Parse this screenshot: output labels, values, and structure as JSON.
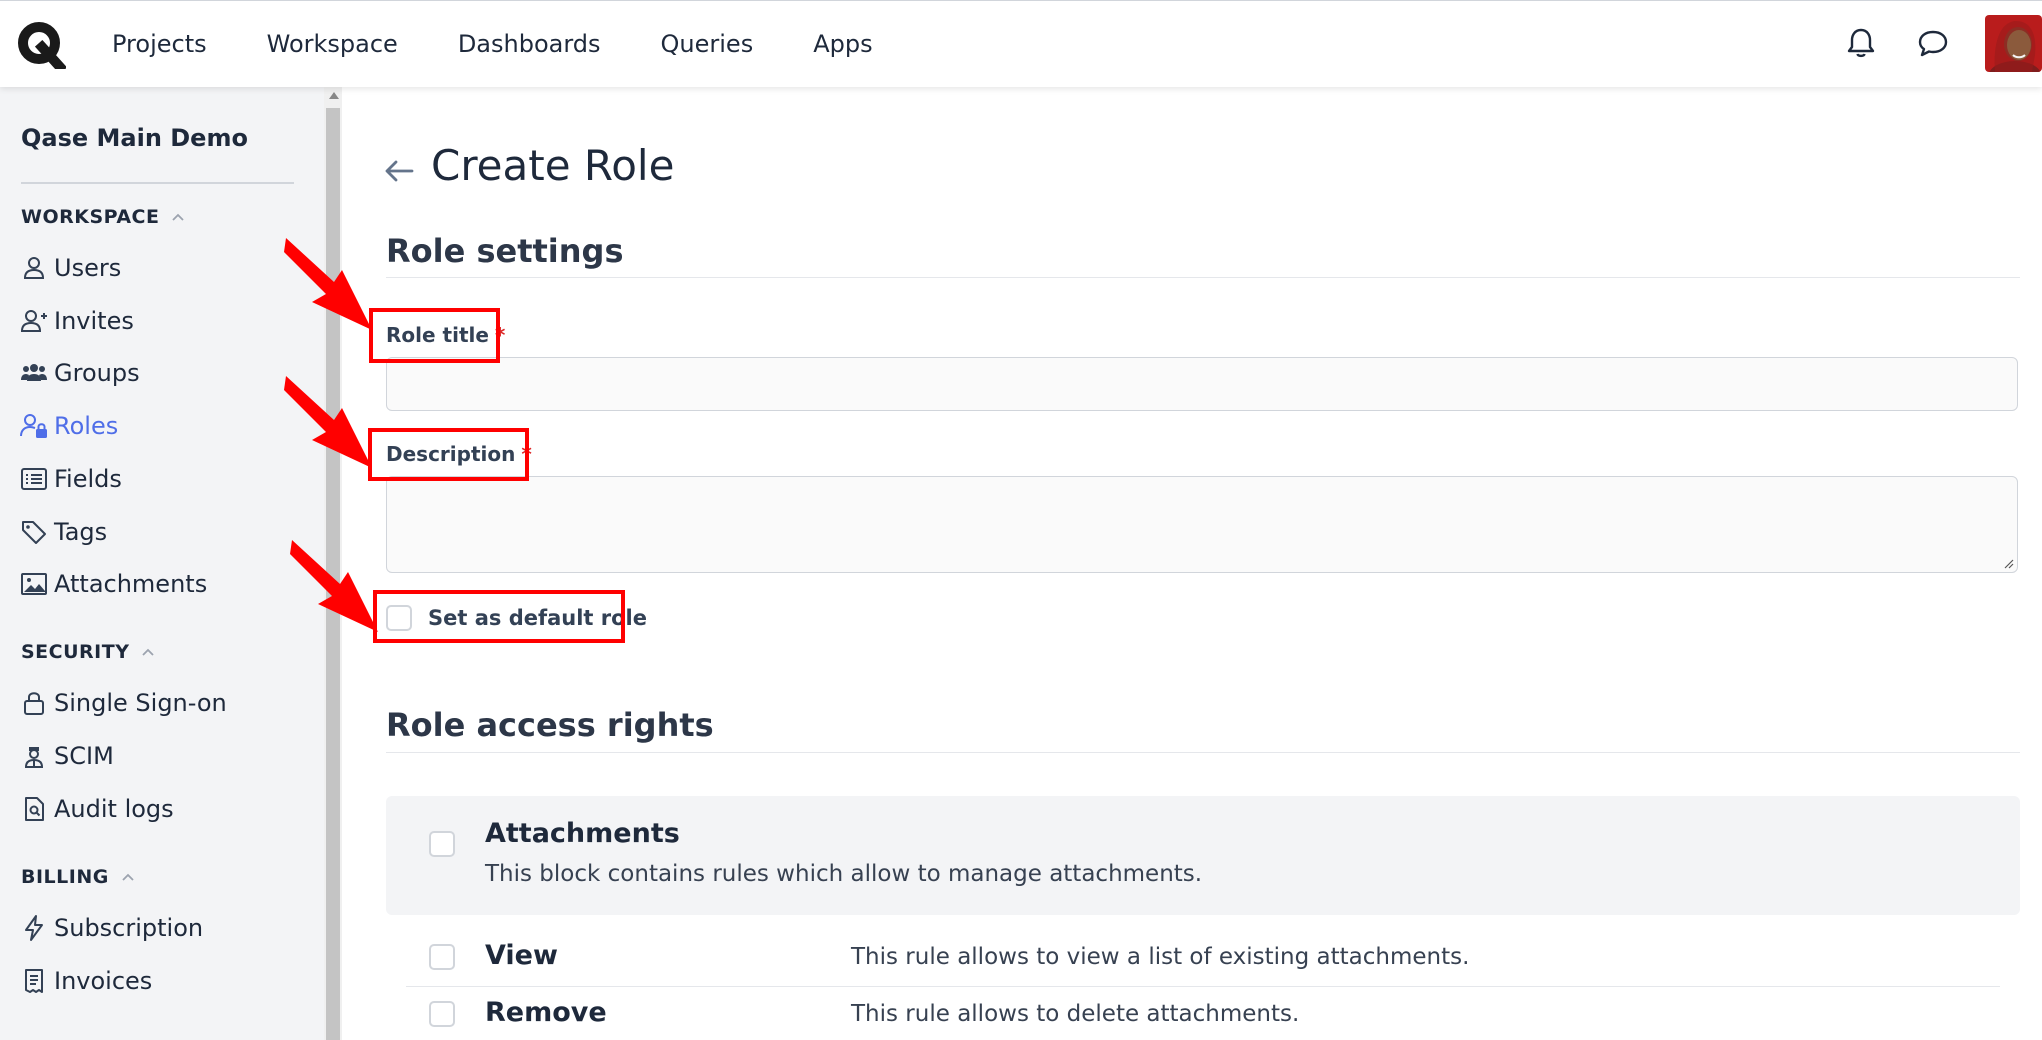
{
  "topnav": {
    "items": [
      "Projects",
      "Workspace",
      "Dashboards",
      "Queries",
      "Apps"
    ],
    "icons": [
      "logo-icon",
      "bell-icon",
      "chat-icon",
      "avatar"
    ]
  },
  "sidebar": {
    "project_name": "Qase Main Demo",
    "sections": [
      {
        "title": "WORKSPACE",
        "items": [
          {
            "label": "Users",
            "icon": "user-icon"
          },
          {
            "label": "Invites",
            "icon": "user-plus-icon"
          },
          {
            "label": "Groups",
            "icon": "users-icon"
          },
          {
            "label": "Roles",
            "icon": "user-lock-icon",
            "active": true
          },
          {
            "label": "Fields",
            "icon": "list-icon"
          },
          {
            "label": "Tags",
            "icon": "tags-icon"
          },
          {
            "label": "Attachments",
            "icon": "image-icon"
          }
        ]
      },
      {
        "title": "SECURITY",
        "items": [
          {
            "label": "Single Sign-on",
            "icon": "lock-icon"
          },
          {
            "label": "SCIM",
            "icon": "user-tie-icon"
          },
          {
            "label": "Audit logs",
            "icon": "file-search-icon"
          }
        ]
      },
      {
        "title": "BILLING",
        "items": [
          {
            "label": "Subscription",
            "icon": "bolt-icon"
          },
          {
            "label": "Invoices",
            "icon": "receipt-icon"
          }
        ]
      }
    ]
  },
  "page": {
    "title": "Create Role",
    "role_settings": {
      "heading": "Role settings",
      "role_title_label": "Role title",
      "required_mark": "*",
      "role_title_value": "",
      "description_label": "Description",
      "description_value": "",
      "default_role_label": "Set as default role",
      "default_role_checked": false
    },
    "access_rights": {
      "heading": "Role access rights",
      "block_title": "Attachments",
      "block_desc": "This block contains rules which allow to manage attachments.",
      "rules": [
        {
          "name": "View",
          "desc": "This rule allows to view a list of existing attachments.",
          "checked": false
        },
        {
          "name": "Remove",
          "desc": "This rule allows to delete attachments.",
          "checked": false
        }
      ]
    }
  },
  "colors": {
    "accent": "#4f6ee8",
    "annotation": "#ff0000",
    "required": "#dc2626"
  }
}
